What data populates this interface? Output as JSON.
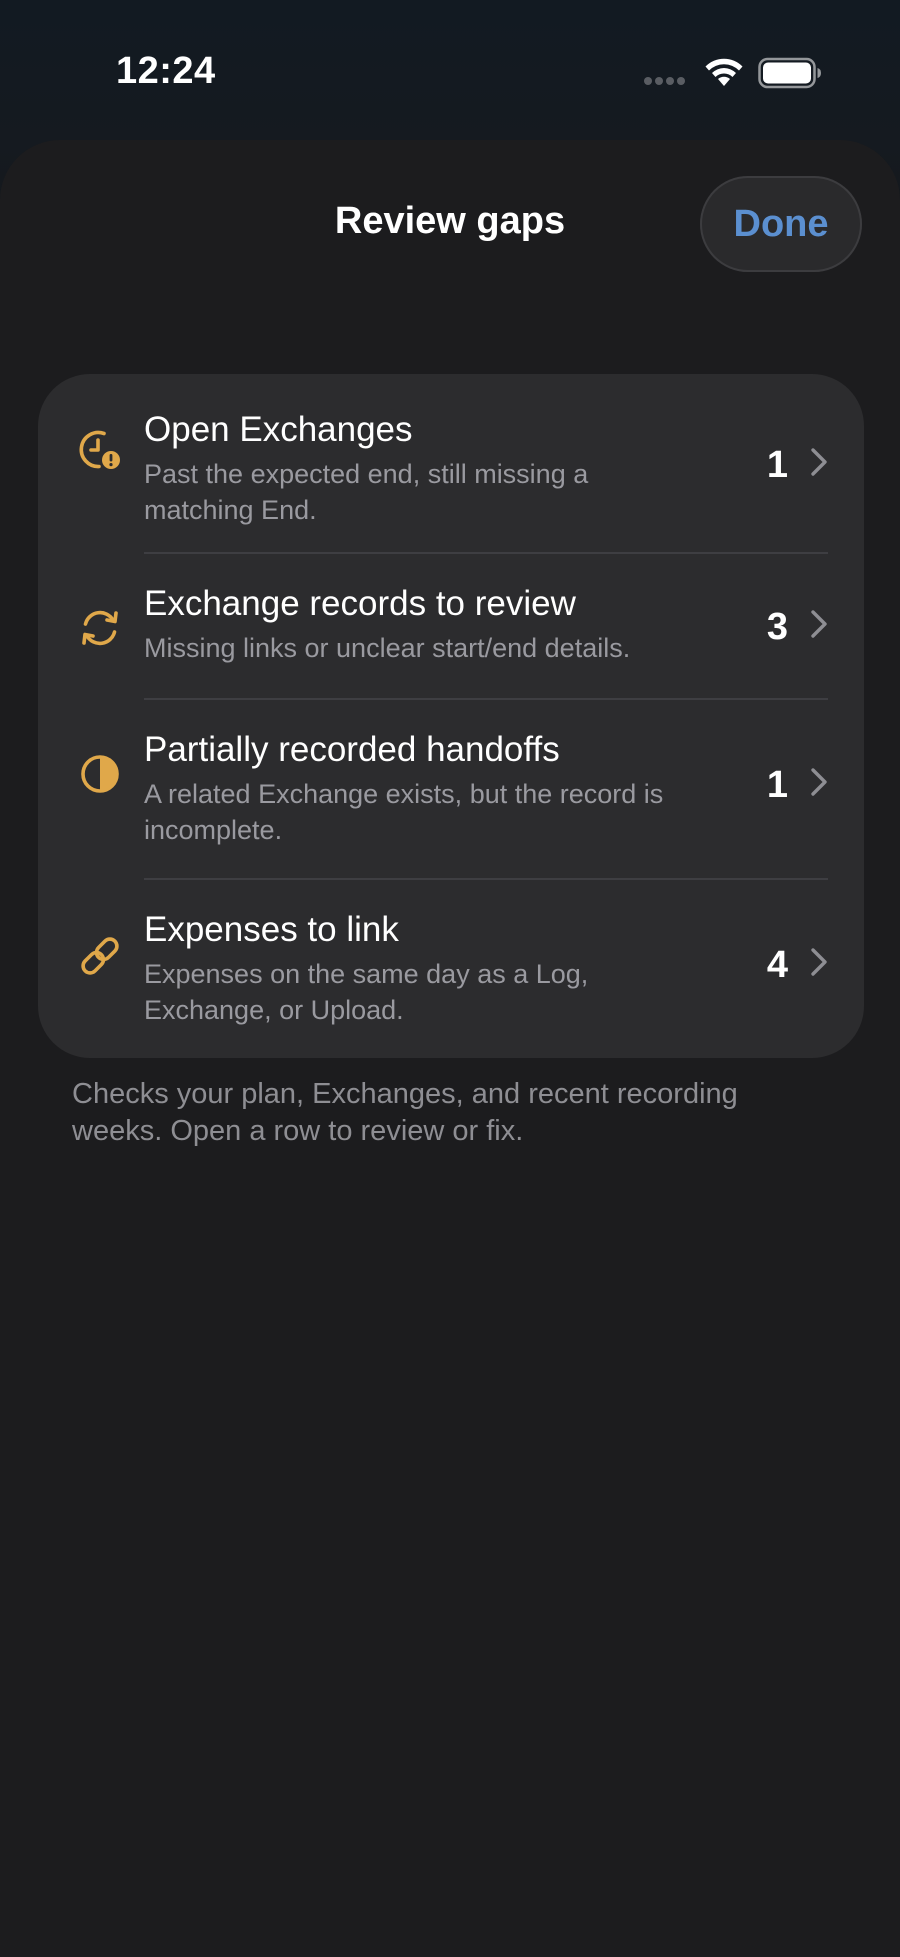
{
  "status_bar": {
    "time": "12:24"
  },
  "sheet": {
    "title": "Review gaps",
    "done_label": "Done"
  },
  "rows": [
    {
      "title": "Open Exchanges",
      "subtitle": "Past the expected end, still missing a matching End.",
      "count": "1",
      "icon": "clock-alert-icon"
    },
    {
      "title": "Exchange records to review",
      "subtitle": "Missing links or unclear start/end details.",
      "count": "3",
      "icon": "sync-arrows-icon"
    },
    {
      "title": "Partially recorded handoffs",
      "subtitle": "A related Exchange exists, but the record is incomplete.",
      "count": "1",
      "icon": "half-circle-icon"
    },
    {
      "title": "Expenses to link",
      "subtitle": "Expenses on the same day as a Log, Exchange, or Upload.",
      "count": "4",
      "icon": "link-icon"
    }
  ],
  "footer_note": "Checks your plan, Exchanges, and recent recording weeks. Open a row to review or fix.",
  "colors": {
    "accent_icon": "#e0a84a",
    "done_text": "#5b8fd0",
    "sheet_background": "#1c1c1e",
    "card_background": "#2c2c2e"
  }
}
